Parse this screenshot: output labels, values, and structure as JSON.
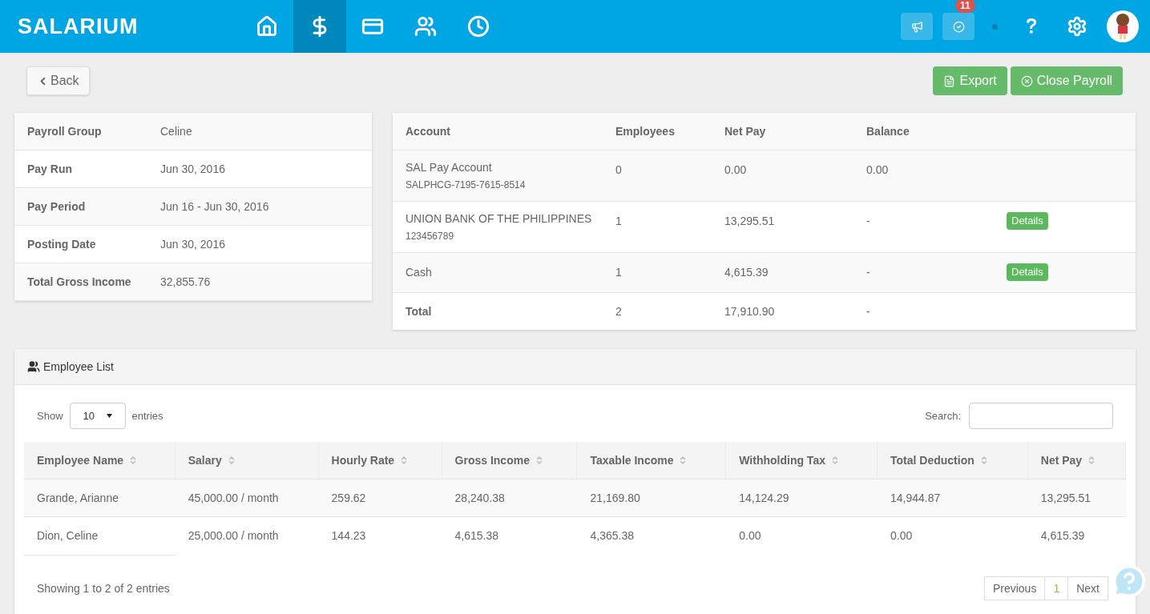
{
  "header": {
    "logo": "SALARIUM",
    "nav_items": [
      {
        "selected": false
      },
      {
        "selected": true
      },
      {
        "selected": false
      },
      {
        "selected": false
      },
      {
        "selected": false
      }
    ],
    "notification_count": "11"
  },
  "toolbar": {
    "back": "Back",
    "export": "Export",
    "close_payroll": "Close Payroll"
  },
  "summary": [
    {
      "label": "Payroll Group",
      "value": "Celine"
    },
    {
      "label": "Pay Run",
      "value": "Jun 30, 2016"
    },
    {
      "label": "Pay Period",
      "value": "Jun 16 - Jun 30, 2016"
    },
    {
      "label": "Posting Date",
      "value": "Jun 30, 2016"
    },
    {
      "label": "Total Gross Income",
      "value": "32,855.76"
    }
  ],
  "accounts": {
    "columns": [
      "Account",
      "Employees",
      "Net Pay",
      "Balance"
    ],
    "rows": [
      {
        "account": "SAL Pay Account",
        "number": "SALPHCG-7195-7615-8514",
        "employees": "0",
        "net_pay": "0.00",
        "balance": "0.00"
      },
      {
        "account": "UNION BANK OF THE PHILIPPINES",
        "number": "123456789",
        "employees": "1",
        "net_pay": "13,295.51",
        "balance": "-",
        "action": "Details"
      },
      {
        "account": "Cash",
        "employees": "1",
        "net_pay": "4,615.39",
        "balance": "-",
        "action": "Details"
      }
    ],
    "total": {
      "label": "Total",
      "employees": "2",
      "net_pay": "17,910.90",
      "balance": "-"
    }
  },
  "employee_list": {
    "title": "Employee List",
    "show_label": "Show",
    "page_size": "10",
    "entries_label": "entries",
    "search_label": "Search:",
    "columns": [
      "Employee Name",
      "Salary",
      "Hourly Rate",
      "Gross Income",
      "Taxable Income",
      "Withholding Tax",
      "Total Deduction",
      "Net Pay"
    ],
    "rows": [
      [
        "Grande, Arianne",
        "45,000.00 / month",
        "259.62",
        "28,240.38",
        "21,169.80",
        "14,124.29",
        "14,944.87",
        "13,295.51"
      ],
      [
        "Dion, Celine",
        "25,000.00 / month",
        "144.23",
        "4,615.38",
        "4,365.38",
        "0.00",
        "0.00",
        "4,615.39"
      ]
    ],
    "info": "Showing 1 to 2 of 2 entries",
    "pagination": [
      {
        "label": "Previous",
        "selected": false
      },
      {
        "label": "1",
        "selected": true
      },
      {
        "label": "Next",
        "selected": false
      }
    ]
  }
}
